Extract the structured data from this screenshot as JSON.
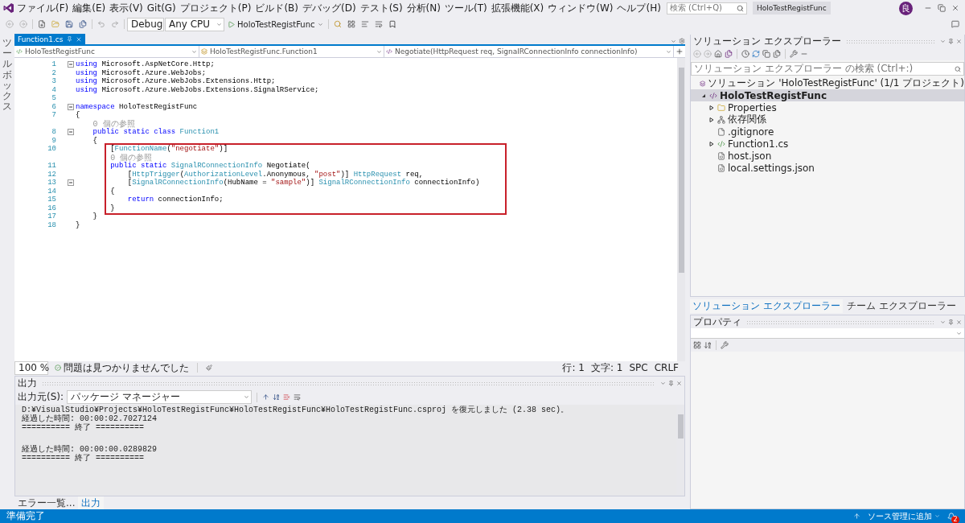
{
  "title_bar": {
    "menus": [
      "ファイル(F)",
      "編集(E)",
      "表示(V)",
      "Git(G)",
      "プロジェクト(P)",
      "ビルド(B)",
      "デバッグ(D)",
      "テスト(S)",
      "分析(N)",
      "ツール(T)",
      "拡張機能(X)",
      "ウィンドウ(W)",
      "ヘルプ(H)"
    ],
    "search": {
      "placeholder": "検索 (Ctrl+Q)"
    },
    "solution_name": "HoloTestRegistFunc",
    "avatar": "良"
  },
  "toolbar": {
    "configuration": "Debug",
    "platform": "Any CPU",
    "start": "HoloTestRegistFunc"
  },
  "toolbox": {
    "label": "ツールボックス"
  },
  "document_tabs": [
    {
      "label": "Function1.cs",
      "selected": true
    }
  ],
  "navigation": {
    "project": "HoloTestRegistFunc",
    "type": "HoloTestRegistFunc.Function1",
    "member": "Negotiate(HttpRequest req, SignalRConnectionInfo connectionInfo)"
  },
  "code": {
    "lines": [
      {
        "number": "1",
        "fold": true,
        "highlighted": false,
        "tokens": [
          {
            "kind": "keyword",
            "text": "using"
          },
          {
            "kind": "plain",
            "text": " Microsoft.AspNetCore.Http;"
          }
        ]
      },
      {
        "number": "2",
        "fold": false,
        "highlighted": false,
        "tokens": [
          {
            "kind": "keyword",
            "text": "using"
          },
          {
            "kind": "plain",
            "text": " Microsoft.Azure.WebJobs;"
          }
        ]
      },
      {
        "number": "3",
        "fold": false,
        "highlighted": false,
        "tokens": [
          {
            "kind": "keyword",
            "text": "using"
          },
          {
            "kind": "plain",
            "text": " Microsoft.Azure.WebJobs.Extensions.Http;"
          }
        ]
      },
      {
        "number": "4",
        "fold": false,
        "highlighted": false,
        "tokens": [
          {
            "kind": "keyword",
            "text": "using"
          },
          {
            "kind": "plain",
            "text": " Microsoft.Azure.WebJobs.Extensions.SignalRService;"
          }
        ]
      },
      {
        "number": "5",
        "fold": false,
        "highlighted": false
      },
      {
        "number": "6",
        "fold": true,
        "highlighted": false,
        "tokens": [
          {
            "kind": "keyword",
            "text": "namespace"
          },
          {
            "kind": "plain",
            "text": " HoloTestRegistFunc"
          }
        ]
      },
      {
        "number": "7",
        "fold": false,
        "highlighted": false,
        "tokens": [
          {
            "kind": "plain",
            "text": "{"
          }
        ],
        "children": [
          {
            "fold": false,
            "highlighted": false,
            "tokens": [
              {
                "kind": "codelens",
                "text": "0 個の参照"
              }
            ]
          },
          {
            "number": "8",
            "fold": true,
            "highlighted": false,
            "tokens": [
              {
                "kind": "keyword",
                "text": "public static class"
              },
              {
                "kind": "type",
                "text": " Function1"
              }
            ]
          },
          {
            "number": "9",
            "fold": false,
            "highlighted": false,
            "tokens": [
              {
                "kind": "plain",
                "text": "{"
              }
            ],
            "children": [
              {
                "number": "10",
                "fold": false,
                "highlighted": true,
                "tokens": [
                  {
                    "kind": "plain",
                    "text": "["
                  },
                  {
                    "kind": "type",
                    "text": "FunctionName"
                  },
                  {
                    "kind": "plain",
                    "text": "("
                  },
                  {
                    "kind": "string",
                    "text": "\"negotiate\""
                  },
                  {
                    "kind": "plain",
                    "text": ")]"
                  }
                ]
              },
              {
                "fold": false,
                "highlighted": true,
                "tokens": [
                  {
                    "kind": "codelens",
                    "text": "0 個の参照"
                  }
                ]
              },
              {
                "number": "11",
                "fold": false,
                "highlighted": true,
                "tokens": [
                  {
                    "kind": "keyword",
                    "text": "public static"
                  },
                  {
                    "kind": "type",
                    "text": " SignalRConnectionInfo"
                  },
                  {
                    "kind": "plain",
                    "text": " Negotiate("
                  }
                ],
                "children": [
                  {
                    "number": "12",
                    "fold": false,
                    "highlighted": true,
                    "tokens": [
                      {
                        "kind": "plain",
                        "text": "["
                      },
                      {
                        "kind": "type",
                        "text": "HttpTrigger"
                      },
                      {
                        "kind": "plain",
                        "text": "("
                      },
                      {
                        "kind": "type",
                        "text": "AuthorizationLevel"
                      },
                      {
                        "kind": "plain",
                        "text": ".Anonymous, "
                      },
                      {
                        "kind": "string",
                        "text": "\"post\""
                      },
                      {
                        "kind": "plain",
                        "text": ")] "
                      },
                      {
                        "kind": "type",
                        "text": "HttpRequest"
                      },
                      {
                        "kind": "plain",
                        "text": " req,"
                      }
                    ]
                  },
                  {
                    "number": "13",
                    "fold": true,
                    "highlighted": true,
                    "tokens": [
                      {
                        "kind": "plain",
                        "text": "["
                      },
                      {
                        "kind": "type",
                        "text": "SignalRConnectionInfo"
                      },
                      {
                        "kind": "plain",
                        "text": "(HubName = "
                      },
                      {
                        "kind": "string",
                        "text": "\"sample\""
                      },
                      {
                        "kind": "plain",
                        "text": ")] "
                      },
                      {
                        "kind": "type",
                        "text": "SignalRConnectionInfo"
                      },
                      {
                        "kind": "plain",
                        "text": " connectionInfo)"
                      }
                    ]
                  }
                ]
              },
              {
                "number": "14",
                "fold": false,
                "highlighted": true,
                "tokens": [
                  {
                    "kind": "plain",
                    "text": "{"
                  }
                ],
                "children": [
                  {
                    "number": "15",
                    "fold": false,
                    "highlighted": true,
                    "tokens": [
                      {
                        "kind": "keyword",
                        "text": "return"
                      },
                      {
                        "kind": "plain",
                        "text": " connectionInfo;"
                      }
                    ]
                  }
                ]
              },
              {
                "number": "16",
                "fold": false,
                "highlighted": true,
                "tokens": [
                  {
                    "kind": "plain",
                    "text": "}"
                  }
                ]
              }
            ]
          },
          {
            "number": "17",
            "fold": false,
            "highlighted": false,
            "tokens": [
              {
                "kind": "plain",
                "text": "}"
              }
            ]
          }
        ]
      },
      {
        "number": "18",
        "fold": false,
        "highlighted": false,
        "tokens": [
          {
            "kind": "plain",
            "text": "}"
          }
        ]
      }
    ]
  },
  "editor_status": {
    "zoom": "100 %",
    "issues": "問題は見つかりませんでした",
    "line": "行: 1",
    "column": "文字: 1",
    "whitespace": "SPC",
    "line_ending": "CRLF"
  },
  "output": {
    "title": "出力",
    "source_label": "出力元(S):",
    "source": "パッケージ マネージャー",
    "blocks": [
      [
        "D:¥VisualStudio¥Projects¥HoloTestRegistFunc¥HoloTestRegistFunc¥HoloTestRegistFunc.csproj を復元しました (2.38 sec)。",
        "経過した時間: 00:00:02.7027124",
        "========== 終了 =========="
      ],
      [
        "経過した時間: 00:00:00.0289829",
        "========== 終了 =========="
      ]
    ]
  },
  "bottom_tabs": [
    {
      "label": "エラー一覧...",
      "selected": false
    },
    {
      "label": "出力",
      "selected": true
    }
  ],
  "solution_explorer": {
    "title": "ソリューション エクスプローラー",
    "search": {
      "placeholder": "ソリューション エクスプローラー の検索 (Ctrl+:)"
    },
    "tree": [
      {
        "label": "ソリューション 'HoloTestRegistFunc' (1/1 プロジェクト)",
        "kind": "solution",
        "selected": false,
        "children": [
          {
            "label": "HoloTestRegistFunc",
            "kind": "project",
            "expanded": true,
            "selected": true,
            "children": [
              {
                "label": "Properties",
                "kind": "folder",
                "expanded": false,
                "selected": false
              },
              {
                "label": "依存関係",
                "kind": "dependencies",
                "expanded": false,
                "selected": false
              },
              {
                "label": ".gitignore",
                "kind": "file",
                "selected": false
              },
              {
                "label": "Function1.cs",
                "kind": "csharp",
                "expanded": false,
                "selected": false
              },
              {
                "label": "host.json",
                "kind": "json",
                "selected": false
              },
              {
                "label": "local.settings.json",
                "kind": "json",
                "selected": false
              }
            ]
          }
        ]
      }
    ]
  },
  "panel_tabs": [
    {
      "label": "ソリューション エクスプローラー",
      "selected": true
    },
    {
      "label": "チーム エクスプローラー",
      "selected": false
    }
  ],
  "properties": {
    "title": "プロパティ"
  },
  "status_bar": {
    "message": "準備完了",
    "source_control": "ソース管理に追加",
    "notifications": "2"
  }
}
